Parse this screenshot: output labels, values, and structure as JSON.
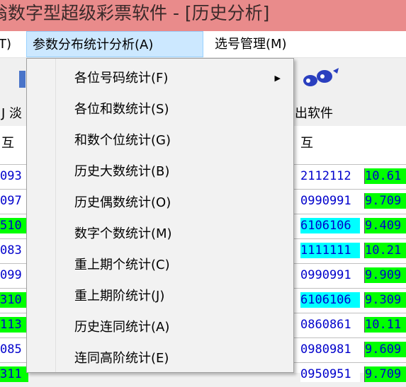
{
  "window": {
    "title": "翁数字型超级彩票软件 - [历史分析]"
  },
  "menubar": {
    "partial_label": "T)",
    "active_label": "参数分布统计分析(A)",
    "select_label": "选号管理(M)"
  },
  "toolbar": {
    "frag_left": "J 淡",
    "frag_right": "出软件"
  },
  "table": {
    "head_left": "互",
    "head_code": "互",
    "rows": [
      {
        "left": "093",
        "code": "2112112",
        "score": "10.61"
      },
      {
        "left": "097",
        "code": "0990991",
        "score": "9.709"
      },
      {
        "left": "510",
        "code": "6106106",
        "score": "9.409"
      },
      {
        "left": "083",
        "code": "1111111",
        "score": "10.21"
      },
      {
        "left": "099",
        "code": "0990991",
        "score": "9.909"
      },
      {
        "left": "310",
        "code": "6106106",
        "score": "9.309"
      },
      {
        "left": "113",
        "code": "0860861",
        "score": "10.11"
      },
      {
        "left": "085",
        "code": "0980981",
        "score": "9.609"
      },
      {
        "left": "311",
        "code": "0950951",
        "score": "9.709"
      },
      {
        "left": "",
        "code": "",
        "score": ""
      }
    ]
  },
  "dropdown": {
    "items": [
      {
        "label": "各位号码统计(F)",
        "has_submenu": true
      },
      {
        "label": "各位和数统计(S)"
      },
      {
        "label": "和数个位统计(G)"
      },
      {
        "label": "历史大数统计(B)"
      },
      {
        "label": "历史偶数统计(O)"
      },
      {
        "label": "数字个数统计(M)"
      },
      {
        "label": "重上期个统计(C)"
      },
      {
        "label": "重上期阶统计(J)"
      },
      {
        "label": "历史连同统计(A)"
      },
      {
        "label": "连同高阶统计(E)"
      }
    ],
    "submenu_arrow": "▶"
  },
  "colors": {
    "titlebar": "#e98b8b",
    "menu_highlight": "#cce8ff",
    "cell_cyan": "#00ffff",
    "cell_green": "#00ff00"
  }
}
